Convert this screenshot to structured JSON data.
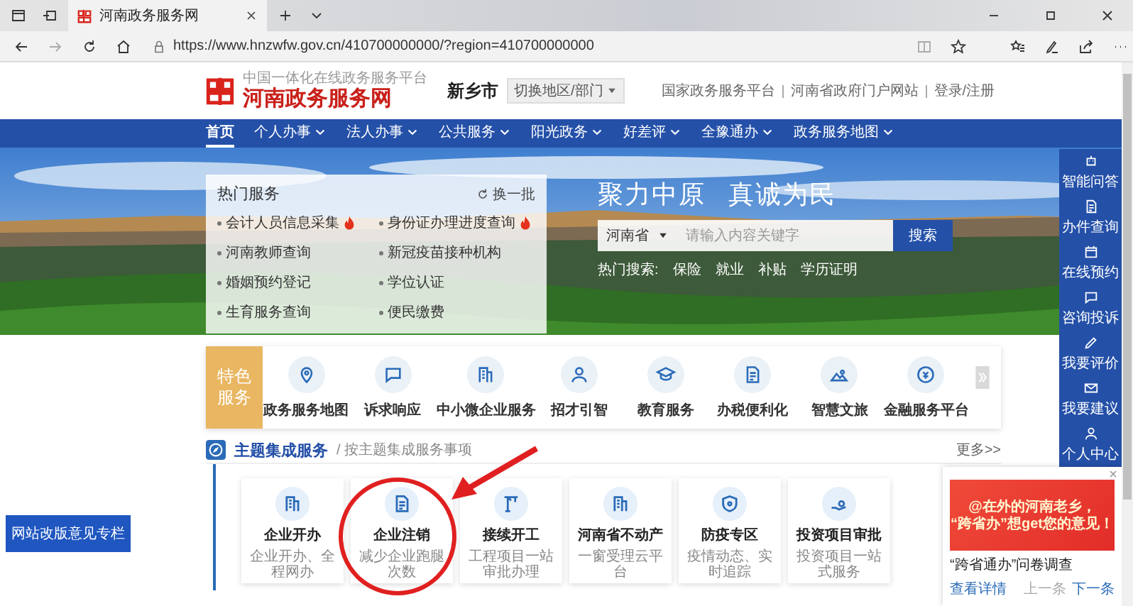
{
  "browser": {
    "tab_title": "河南政务服务网",
    "url": "https://www.hnzwfw.gov.cn/410700000000/?region=410700000000"
  },
  "header": {
    "logo_tagline": "中国一体化在线政务服务平台",
    "logo_title": "河南政务服务网",
    "city": "新乡市",
    "switch": "切换地区/部门",
    "links": [
      "国家政务服务平台",
      "河南省政府门户网站",
      "登录/注册"
    ]
  },
  "nav": [
    {
      "label": "首页",
      "selected": true,
      "dropdown": false
    },
    {
      "label": "个人办事",
      "selected": false,
      "dropdown": true
    },
    {
      "label": "法人办事",
      "selected": false,
      "dropdown": true
    },
    {
      "label": "公共服务",
      "selected": false,
      "dropdown": true
    },
    {
      "label": "阳光政务",
      "selected": false,
      "dropdown": true
    },
    {
      "label": "好差评",
      "selected": false,
      "dropdown": true
    },
    {
      "label": "全豫通办",
      "selected": false,
      "dropdown": true
    },
    {
      "label": "政务服务地图",
      "selected": false,
      "dropdown": true
    }
  ],
  "hot_services": {
    "title": "热门服务",
    "refresh": "换一批",
    "items": [
      {
        "label": "会计人员信息采集",
        "hot": true
      },
      {
        "label": "身份证办理进度查询",
        "hot": true
      },
      {
        "label": "河南教师查询",
        "hot": false
      },
      {
        "label": "新冠疫苗接种机构",
        "hot": false
      },
      {
        "label": "婚姻预约登记",
        "hot": false
      },
      {
        "label": "学位认证",
        "hot": false
      },
      {
        "label": "生育服务查询",
        "hot": false
      },
      {
        "label": "便民缴费",
        "hot": false
      }
    ]
  },
  "hero": {
    "slogan": [
      "聚力中原",
      "真诚为民"
    ],
    "search": {
      "region": "河南省",
      "placeholder": "请输入内容关键字",
      "button": "搜索"
    },
    "hot_search_label": "热门搜索:",
    "hot_searches": [
      "保险",
      "就业",
      "补贴",
      "学历证明"
    ]
  },
  "sidebar": [
    "智能问答",
    "办件查询",
    "在线预约",
    "咨询投诉",
    "我要评价",
    "我要建议",
    "个人中心"
  ],
  "features": {
    "badge": "特色服务",
    "items": [
      "政务服务地图",
      "诉求响应",
      "中小微企业服务",
      "招才引智",
      "教育服务",
      "办税便利化",
      "智慧文旅",
      "金融服务平台"
    ]
  },
  "section": {
    "title": "主题集成服务",
    "subtitle": "/ 按主题集成服务事项",
    "more": "更多>>"
  },
  "cards": [
    {
      "title": "企业开办",
      "subtitle": "企业开办、全程网办"
    },
    {
      "title": "企业注销",
      "subtitle": "减少企业跑腿次数"
    },
    {
      "title": "接续开工",
      "subtitle": "工程项目一站审批办理"
    },
    {
      "title": "河南省不动产",
      "subtitle": "一窗受理云平台"
    },
    {
      "title": "防疫专区",
      "subtitle": "疫情动态、实时追踪"
    },
    {
      "title": "投资项目审批",
      "subtitle": "投资项目一站式服务"
    }
  ],
  "feedback_button": "网站改版意见专栏",
  "popup": {
    "banner": [
      "@在外的河南老乡，",
      "“跨省办”想get您的意见！"
    ],
    "title": "“跨省通办”问卷调查",
    "link": "查看详情",
    "prev": "上一条",
    "next": "下一条"
  }
}
